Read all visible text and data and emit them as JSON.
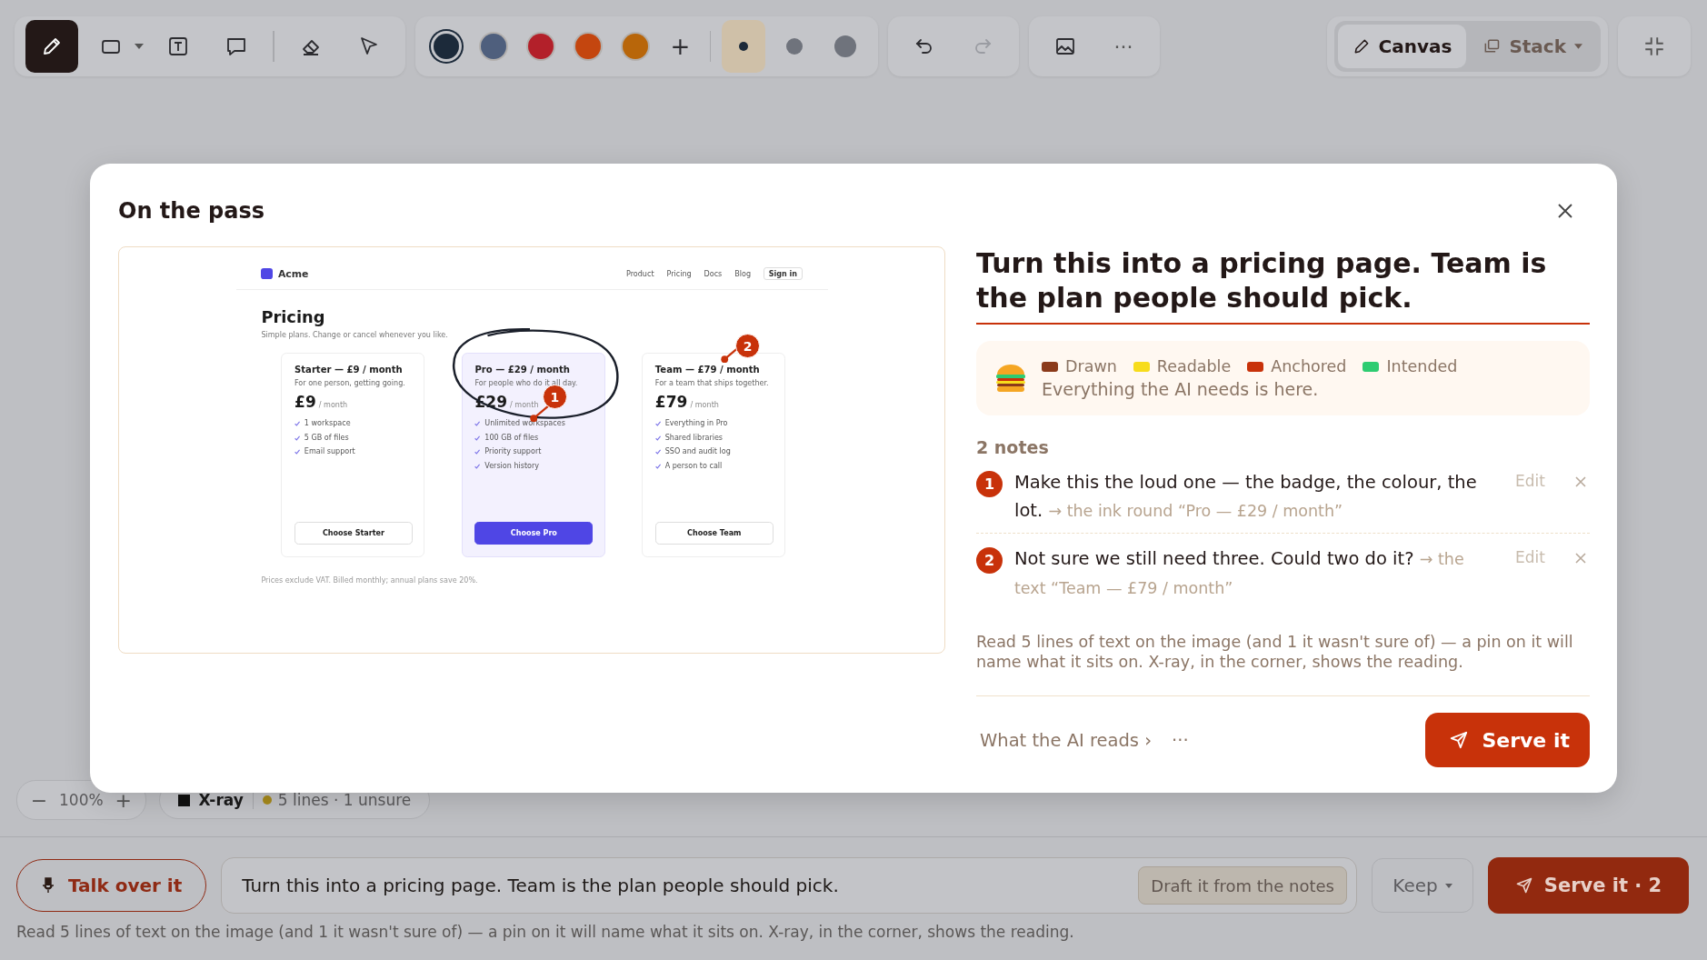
{
  "toolbar": {
    "tools": [
      {
        "kind": "pen",
        "selected": true,
        "dropdown": false
      },
      {
        "kind": "rect",
        "selected": false,
        "dropdown": true
      },
      {
        "kind": "text",
        "selected": false,
        "dropdown": false
      },
      {
        "kind": "comment",
        "selected": false,
        "dropdown": false
      },
      {
        "kind": "eraser",
        "selected": false,
        "dropdown": false
      },
      {
        "kind": "pointer",
        "selected": false,
        "dropdown": false
      }
    ],
    "colors": [
      {
        "color": "#1c2a3a",
        "selected": true
      },
      {
        "color": "#4f5f7d",
        "selected": false
      },
      {
        "color": "#b3202a",
        "selected": false
      },
      {
        "color": "#c4460f",
        "selected": false
      },
      {
        "color": "#b8660a",
        "selected": false
      }
    ],
    "add_color": "+",
    "sizes": [
      {
        "kind": "small",
        "selected": true
      },
      {
        "kind": "medium",
        "selected": false
      },
      {
        "kind": "large",
        "selected": false
      }
    ],
    "history": [
      {
        "kind": "undo",
        "disabled": false
      },
      {
        "kind": "redo",
        "disabled": true
      }
    ],
    "more": "···",
    "views": [
      {
        "kind": "canvas",
        "label": "Canvas",
        "selected": true,
        "dropdown": false
      },
      {
        "kind": "stack",
        "label": "Stack",
        "selected": false,
        "dropdown": true
      }
    ]
  },
  "zoom": {
    "minus": "−",
    "value": "100%",
    "plus": "+"
  },
  "xray": {
    "label": "X-ray",
    "status": "5 lines · 1 unsure"
  },
  "modal": {
    "title": "On the pass",
    "preview": {
      "brand": "Acme",
      "nav": [
        "Product",
        "Pricing",
        "Docs",
        "Blog"
      ],
      "sign_in": "Sign in",
      "title": "Pricing",
      "subtitle": "Simple plans. Change or cancel whenever you like.",
      "plans": [
        {
          "name": "Starter — £9 / month",
          "tagline": "For one person, getting going.",
          "price": "£9",
          "period": "/ month",
          "features": [
            "1 workspace",
            "5 GB of files",
            "Email support"
          ],
          "button": "Choose Starter",
          "selected": false,
          "circled": false
        },
        {
          "name": "Pro — £29 / month",
          "tagline": "For people who do it all day.",
          "price": "£29",
          "period": "/ month",
          "features": [
            "Unlimited workspaces",
            "100 GB of files",
            "Priority support",
            "Version history"
          ],
          "button": "Choose Pro",
          "selected": true,
          "circled": true,
          "pin": "1"
        },
        {
          "name": "Team — £79 / month",
          "tagline": "For a team that ships together.",
          "price": "£79",
          "period": "/ month",
          "features": [
            "Everything in Pro",
            "Shared libraries",
            "SSO and audit log",
            "A person to call"
          ],
          "button": "Choose Team",
          "selected": false,
          "circled": false,
          "pin": "2"
        }
      ],
      "footnote": "Prices exclude VAT. Billed monthly; annual plans save 20%."
    },
    "prompt": "Turn this into a pricing page. Team is the plan people should pick.",
    "legend": [
      {
        "label": "Drawn",
        "color": "#8b3a1a"
      },
      {
        "label": "Readable",
        "color": "#f7dc1c"
      },
      {
        "label": "Anchored",
        "color": "#c8320a"
      },
      {
        "label": "Intended",
        "color": "#2ecc71"
      }
    ],
    "legend_text": "Everything the AI needs is here.",
    "notes_count": "2 notes",
    "notes": [
      {
        "number": "1",
        "text": "Make this the loud one — the badge, the colour, the lot.",
        "anchor": "→ the ink round “Pro — £29 / month”",
        "edit": "Edit"
      },
      {
        "number": "2",
        "text": "Not sure we still need three. Could two do it?",
        "anchor": "→ the text “Team — £79 / month”",
        "edit": "Edit"
      }
    ],
    "info": "Read 5 lines of text on the image (and 1 it wasn't sure of) — a pin on it will name what it sits on. X-ray, in the corner, shows the reading.",
    "reads_link": "What the AI reads ›",
    "more": "···",
    "serve": "Serve it"
  },
  "bottom": {
    "talk": "Talk over it",
    "prompt": "Turn this into a pricing page. Team is the plan people should pick.",
    "draft": "Draft it from the notes",
    "keep": "Keep",
    "serve": "Serve it · 2",
    "hint": "Read 5 lines of text on the image (and 1 it wasn't sure of) — a pin on it will name what it sits on. X-ray, in the corner, shows the reading."
  }
}
